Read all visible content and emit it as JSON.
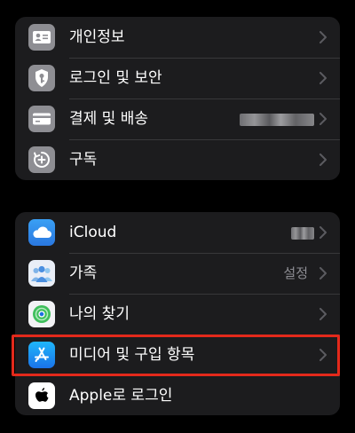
{
  "account_group": {
    "items": [
      {
        "label": "개인정보",
        "icon": "person-card-icon"
      },
      {
        "label": "로그인 및 보안",
        "icon": "shield-key-icon"
      },
      {
        "label": "결제 및 배송",
        "icon": "credit-card-icon"
      },
      {
        "label": "구독",
        "icon": "subscription-plus-icon"
      }
    ]
  },
  "services_group": {
    "items": [
      {
        "label": "iCloud",
        "icon": "icloud-icon"
      },
      {
        "label": "가족",
        "value": "설정",
        "icon": "family-icon"
      },
      {
        "label": "나의 찾기",
        "icon": "find-my-icon"
      },
      {
        "label": "미디어 및 구입 항목",
        "icon": "app-store-icon"
      },
      {
        "label": "Apple로 로그인",
        "icon": "apple-logo-icon"
      }
    ]
  },
  "colors": {
    "background": "#000000",
    "group_background": "#1c1c1e",
    "highlight": "#e3291b",
    "chevron": "#5b5b60",
    "value_text": "#8d8d93"
  }
}
